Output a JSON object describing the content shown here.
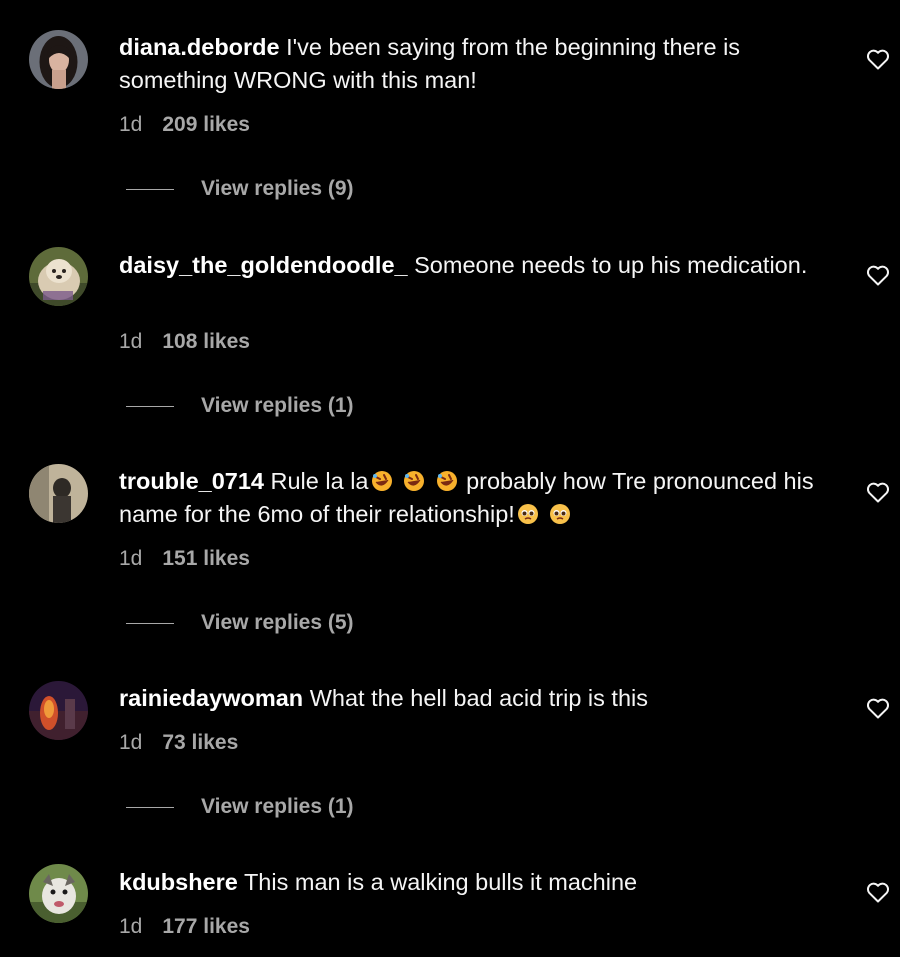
{
  "colors": {
    "background": "#000000",
    "text": "#f5f5f5",
    "secondary": "#a8a8a8"
  },
  "comments": [
    {
      "username": "diana.deborde",
      "text": "I've been saying from the beginning there is something WRONG with this man!",
      "time": "1d",
      "likes": "209 likes",
      "replies": "View replies (9)"
    },
    {
      "username": "daisy_the_goldendoodle_",
      "text": "Someone needs to up his medication.",
      "time": "1d",
      "likes": "108 likes",
      "replies": "View replies (1)"
    },
    {
      "username": "trouble_0714",
      "text_a": "Rule la la",
      "text_b": "probably how Tre pronounced his name for the 6mo of their relationship!",
      "emojis_a": [
        "rofl-emoji",
        "rofl-emoji",
        "rofl-emoji"
      ],
      "emojis_b": [
        "pleading-face-emoji",
        "pleading-face-emoji"
      ],
      "time": "1d",
      "likes": "151 likes",
      "replies": "View replies (5)"
    },
    {
      "username": "rainiedaywoman",
      "text": "What the hell bad acid trip is this",
      "time": "1d",
      "likes": "73 likes",
      "replies": "View replies (1)"
    },
    {
      "username": "kdubshere",
      "text": "This man is a walking bulls  it machine",
      "time": "1d",
      "likes": "177 likes"
    }
  ]
}
